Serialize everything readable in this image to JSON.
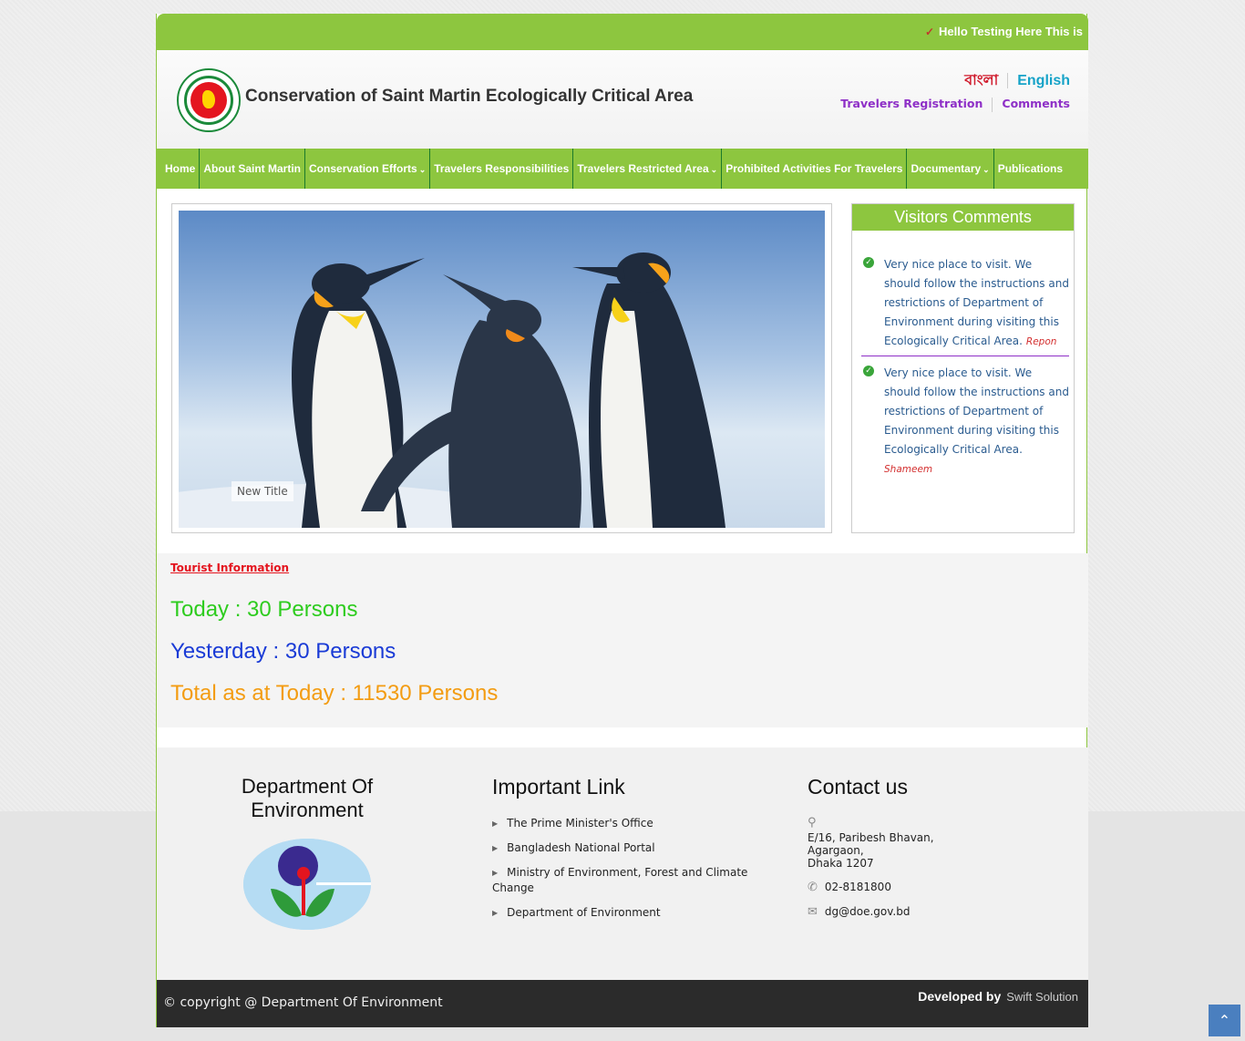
{
  "topbar": {
    "marquee": "Hello Testing Here This is"
  },
  "header": {
    "site_title": "Conservation of Saint Martin Ecologically Critical Area",
    "lang_bangla": "বাংলা",
    "lang_english": "English",
    "travelers_registration": "Travelers Registration",
    "comments": "Comments"
  },
  "nav": {
    "items": [
      {
        "label": "Home"
      },
      {
        "label": "About Saint Martin"
      },
      {
        "label": "Conservation Efforts"
      },
      {
        "label": "Travelers Responsibilities"
      },
      {
        "label": "Travelers Restricted Area"
      },
      {
        "label": "Prohibited Activities For Travelers"
      },
      {
        "label": "Documentary"
      },
      {
        "label": "Publications"
      }
    ]
  },
  "slider": {
    "caption": "New Title"
  },
  "visitors_comments": {
    "title": "Visitors Comments",
    "items": [
      {
        "text": "Very nice place to visit. We should follow the instructions and restrictions of Department of Environment during visiting this Ecologically Critical Area.",
        "author": "Repon"
      },
      {
        "text": "Very nice place to visit. We should follow the instructions and restrictions of Department of Environment during visiting this Ecologically Critical Area.",
        "author": "Shameem"
      }
    ]
  },
  "tourist": {
    "label": "Tourist Information",
    "today": "Today : 30 Persons",
    "yesterday": "Yesterday : 30 Persons",
    "total": "Total as at Today : 11530 Persons",
    "colors": {
      "today": "#2ecc1f",
      "yesterday": "#1a3bd6",
      "total": "#f39c12"
    }
  },
  "footer": {
    "dept_title": "Department Of Environment",
    "important_link_title": "Important Link",
    "links": [
      "The Prime Minister's Office",
      "Bangladesh National Portal",
      "Ministry of Environment, Forest and Climate Change",
      "Department of Environment"
    ],
    "contact_title": "Contact us",
    "address_line1": "E/16, Paribesh Bhavan,",
    "address_line2": "Agargaon,",
    "address_line3": "Dhaka 1207",
    "phone": "02-8181800",
    "email": "dg@doe.gov.bd"
  },
  "bottom": {
    "copyright": "© copyright @ Department Of Environment",
    "developed_by": "Developed by",
    "developer": "Swift Solution"
  },
  "colors": {
    "accent": "#8dc63f",
    "dark": "#2b2b2b"
  },
  "icons": {
    "scroll_top": "chevron-up-icon"
  }
}
